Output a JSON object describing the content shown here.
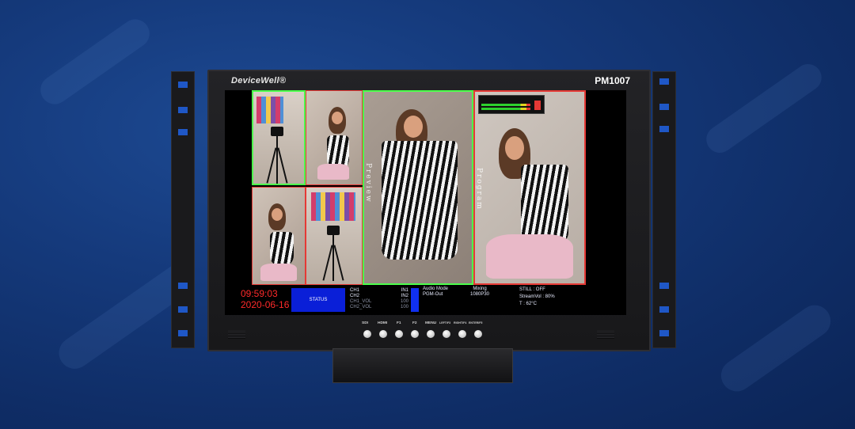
{
  "device": {
    "brand": "DeviceWell®",
    "model": "PM1007"
  },
  "screen": {
    "tiles": [
      {
        "name": "input-1-tile",
        "border": "#4cff4c"
      },
      {
        "name": "input-2-tile",
        "border": "#e53935"
      },
      {
        "name": "input-3-tile",
        "border": "#e53935"
      },
      {
        "name": "input-4-tile",
        "border": "#e53935"
      },
      {
        "name": "preview-tile",
        "border": "#4cff4c",
        "label": "Preview"
      },
      {
        "name": "program-tile",
        "border": "#e53935",
        "label": "Program"
      }
    ],
    "status": {
      "time": "09:59:03",
      "date": "2020-06-16",
      "status_label": "STATUS",
      "channels": [
        "CH1",
        "CH2",
        "CH1_VOL",
        "CH2_VOL"
      ],
      "inputs": [
        "IN1",
        "IN2",
        "100",
        "100"
      ],
      "audio_mode_label": "Audio Mode",
      "audio_mode_value": "PGM-Out",
      "mixing_label": "Mixing",
      "mixing_value": "1080P30",
      "still": "STILL : OFF",
      "stream_vol": "StreamVol : 80%",
      "temperature": "T : 62°C"
    }
  },
  "buttons": [
    {
      "label": "SDI"
    },
    {
      "label": "HDMI"
    },
    {
      "label": "F1"
    },
    {
      "label": "F2"
    },
    {
      "label": "MENU"
    },
    {
      "label": "LEFT/F3"
    },
    {
      "label": "RIGHT/F4"
    },
    {
      "label": "ENTER/F5"
    }
  ]
}
